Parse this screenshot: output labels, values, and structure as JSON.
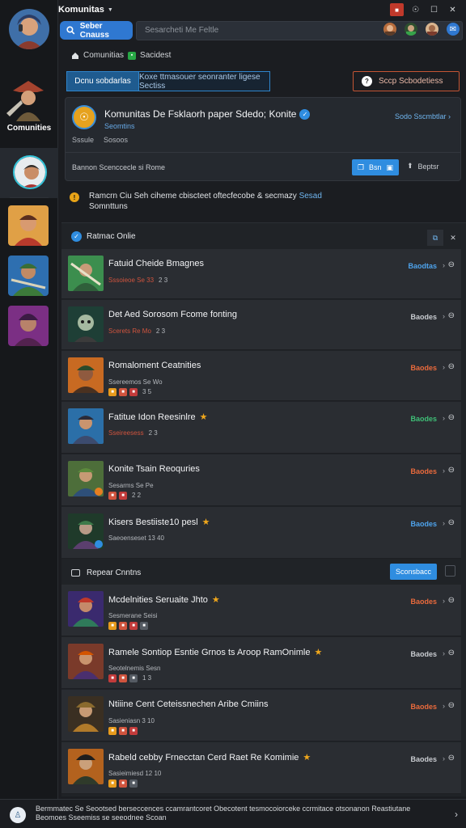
{
  "app": {
    "title": "Komunitas",
    "window_buttons": [
      "■",
      "☉",
      "☐",
      "✕"
    ]
  },
  "rail": {
    "label": "Comunities"
  },
  "search": {
    "button_label": "Seber Cnauss",
    "placeholder": "Sesarcheti Me Feltle"
  },
  "breadcrumb": {
    "item1": "Comunitias",
    "item2": "Sacidest"
  },
  "actions": {
    "seg_a": "Dcnu sobdarlas",
    "seg_b": "Koxe ttmasouer seonranter ligese Sectiss",
    "outline_btn": "Sccp Scbodetiess"
  },
  "community": {
    "title": "Komunitas De Fsklaorh paper Sdedo; Konite",
    "subtitle": "Seomtins",
    "link": "Sodo Sscmbtlar",
    "meta": [
      "Sssule",
      "Sosoos"
    ],
    "note": "Bannon Scenccecle si Rome",
    "join": "Bsn",
    "share": "Beptsr"
  },
  "notice": {
    "text": "Ramcrn Ciu Seh ciheme cbiscteet oftecfecobe & secmazy",
    "link": "Sesad",
    "line2": "Somnttuns"
  },
  "panel": {
    "title": "Ratmac Onlie"
  },
  "rows_top": [
    {
      "title": "Fatuid Cheide Bmagnes",
      "meta": "Sssoieoe Se 33",
      "badge_count": "2 3",
      "status": "Baodtas",
      "status_color": "#4ea3ec",
      "star": false
    },
    {
      "title": "Det Aed Sorosom Fcome fonting",
      "meta": "Scerets Re Mo",
      "badge_count": "2 3",
      "status": "Baodes",
      "status_color": "#c9ccd1",
      "star": false
    },
    {
      "title": "Romaloment Ceatnities",
      "meta": "Ssereemos Se Wo",
      "badge_count": "3 5",
      "status": "Baodes",
      "status_color": "#ea6a3c",
      "star": false
    },
    {
      "title": "Fatitue Idon Reesinlre",
      "meta": "Sseireesess",
      "badge_count": "2 3",
      "status": "Baodes",
      "status_color": "#3fbf77",
      "star": true
    },
    {
      "title": "Konite Tsain Reoquries",
      "meta": "Sesarms Se Pe",
      "badge_count": "2 2",
      "status": "Baodes",
      "status_color": "#ea6a3c",
      "star": false
    },
    {
      "title": "Kisers Bestiiste10 pesl",
      "meta": "Saeoenseset 13 40",
      "badge_count": "",
      "status": "Baodes",
      "status_color": "#4ea3ec",
      "star": true
    }
  ],
  "section": {
    "title": "Repear Cnntns",
    "button": "Sconsbacc"
  },
  "rows_bottom": [
    {
      "title": "Mcdelnities Seruaite Jhto",
      "meta": "Sesmerane Seisi",
      "badge_count": "",
      "status": "Baodes",
      "status_color": "#ea6a3c",
      "star": true
    },
    {
      "title": "Ramele Sontiop Esntie Grnos ts Aroop RamOnimle",
      "meta": "Seotelnemis Sesn",
      "badge_count": "1 3",
      "status": "Baodes",
      "status_color": "#c9ccd1",
      "star": true
    },
    {
      "title": "Ntiiine Cent Ceteissnechen Aribe Cmiins",
      "meta": "Sasieniasn 3 10",
      "badge_count": "",
      "status": "Baodes",
      "status_color": "#ea6a3c",
      "star": false
    },
    {
      "title": "Rabeld cebby Frnecctan Cerd Raet Re Komimie",
      "meta": "Sasieimiesd 12 10",
      "badge_count": "",
      "status": "Baodes",
      "status_color": "#c9ccd1",
      "star": true
    }
  ],
  "footer": {
    "text": "Bermmatec Se Seootsed berseccences ccamrantcoret Obecotent tesmocoiorceke ccrmitace otsonanon Reastiutane Beomoes Sseemiss se seeodnee Scoan"
  }
}
